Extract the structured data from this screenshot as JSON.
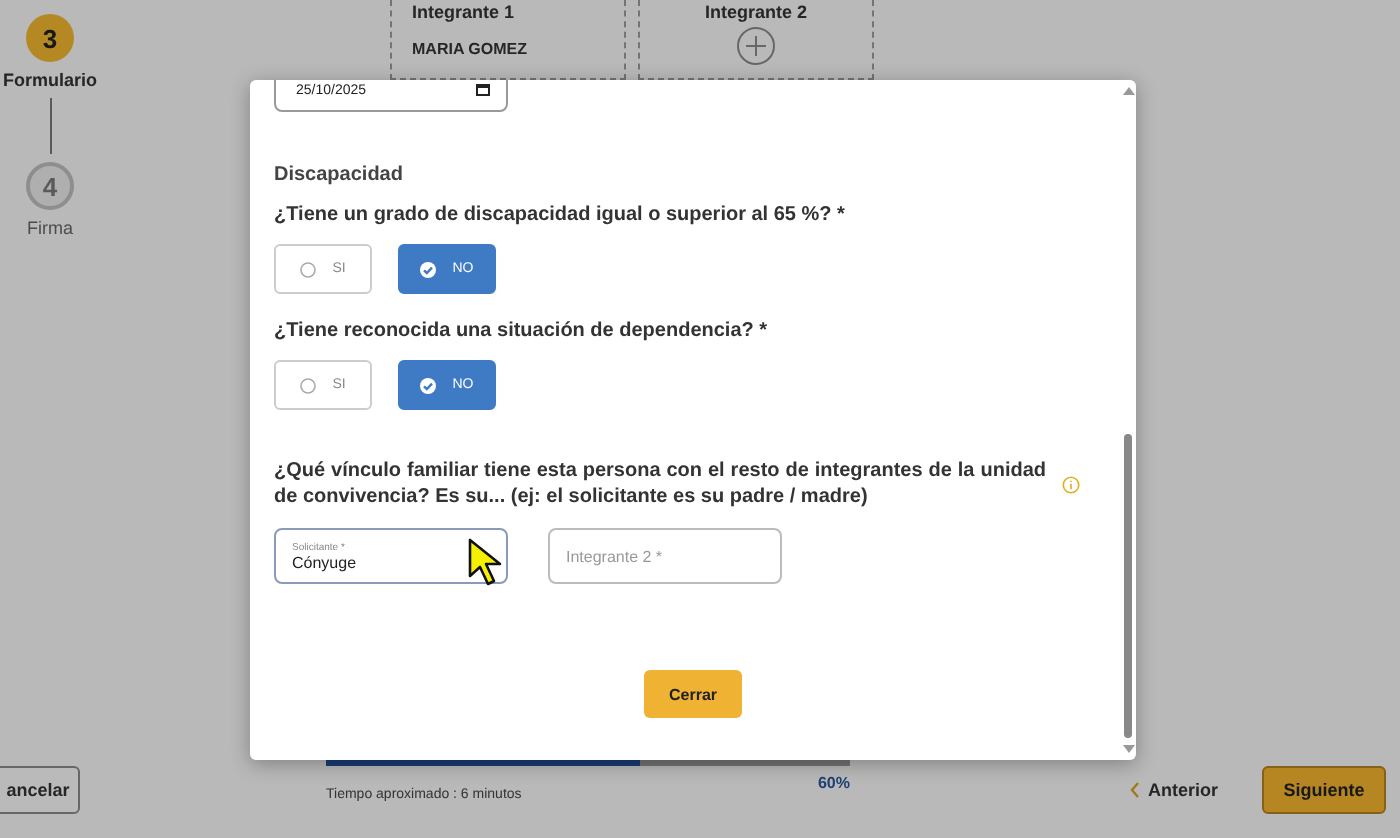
{
  "stepper": [
    {
      "number": "3",
      "label": "Formulario",
      "selected": true
    },
    {
      "number": "4",
      "label": "Firma",
      "selected": false
    }
  ],
  "members": [
    {
      "kind": "filled",
      "title": "Integrante 1",
      "name": "MARIA GOMEZ"
    },
    {
      "kind": "empty",
      "title": "Integrante 2"
    }
  ],
  "footer": {
    "cancel": "ancelar",
    "progress": {
      "level": 0.6,
      "reading": "60%",
      "time": "Tiempo aproximado : 6 minutos"
    },
    "previous": "Anterior",
    "next": "Siguiente"
  },
  "modal": {
    "date_value": "25/10/2025",
    "section": "Discapacidad",
    "questions": [
      {
        "text": "¿Tiene un grado de discapacidad igual o superior al 65 %? *",
        "options": [
          {
            "label": "SI",
            "selected": false
          },
          {
            "label": "NO",
            "selected": true
          }
        ]
      },
      {
        "text": "¿Tiene reconocida una situación de dependencia? *",
        "options": [
          {
            "label": "SI",
            "selected": false
          },
          {
            "label": "NO",
            "selected": true
          }
        ]
      }
    ],
    "relation": {
      "question": "¿Qué vínculo familiar tiene esta persona con el resto de integrantes de la unidad de convivencia? Es su... (ej: el solicitante es su padre / madre)",
      "fields": [
        {
          "label": "Solicitante *",
          "value": "Cónyuge"
        },
        {
          "placeholder": "Integrante 2 *"
        }
      ]
    },
    "close": "Cerrar"
  }
}
